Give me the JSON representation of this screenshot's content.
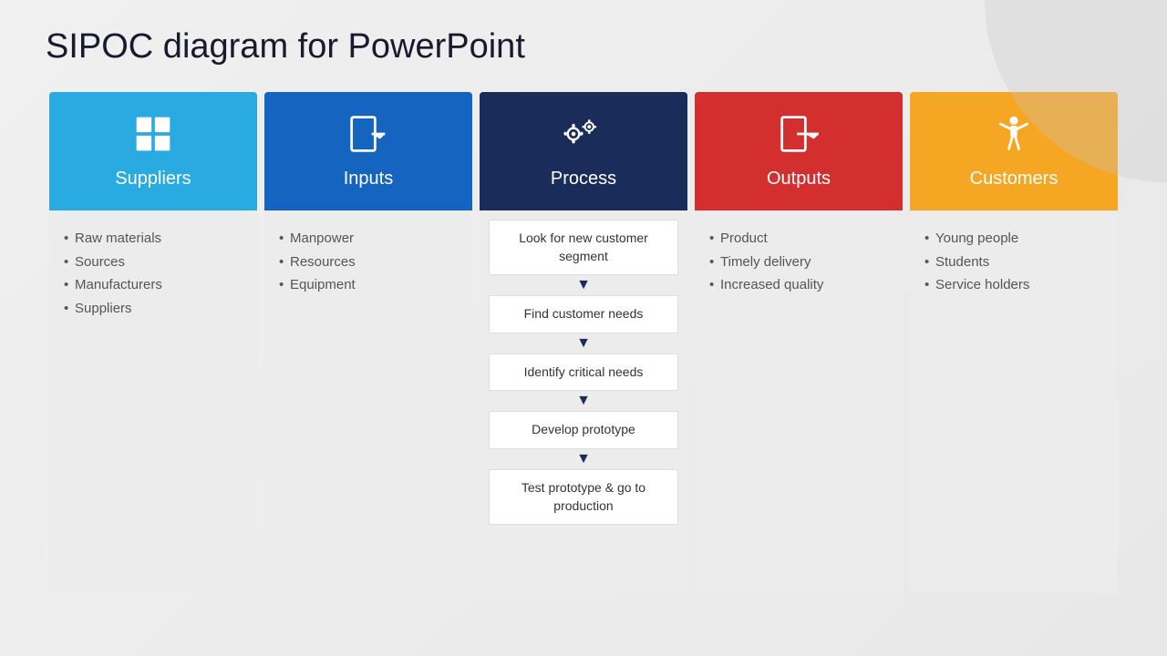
{
  "page": {
    "title": "SIPOC diagram for PowerPoint"
  },
  "columns": [
    {
      "id": "suppliers",
      "label": "Suppliers",
      "color": "#29ABE2",
      "icon": "grid",
      "items": [
        "Raw materials",
        "Sources",
        "Manufacturers",
        "Suppliers"
      ]
    },
    {
      "id": "inputs",
      "label": "Inputs",
      "color": "#1565C0",
      "icon": "input-arrow",
      "items": [
        "Manpower",
        "Resources",
        "Equipment"
      ]
    },
    {
      "id": "process",
      "label": "Process",
      "color": "#1a2d5a",
      "icon": "gears",
      "steps": [
        "Look for new customer segment",
        "Find customer needs",
        "Identify critical needs",
        "Develop prototype",
        "Test prototype & go to production"
      ]
    },
    {
      "id": "outputs",
      "label": "Outputs",
      "color": "#D32F2F",
      "icon": "output-arrow",
      "items": [
        "Product",
        "Timely delivery",
        "Increased quality"
      ]
    },
    {
      "id": "customers",
      "label": "Customers",
      "color": "#F5A623",
      "icon": "person",
      "items": [
        "Young people",
        "Students",
        "Service holders"
      ]
    }
  ],
  "process_arrow": "▼"
}
